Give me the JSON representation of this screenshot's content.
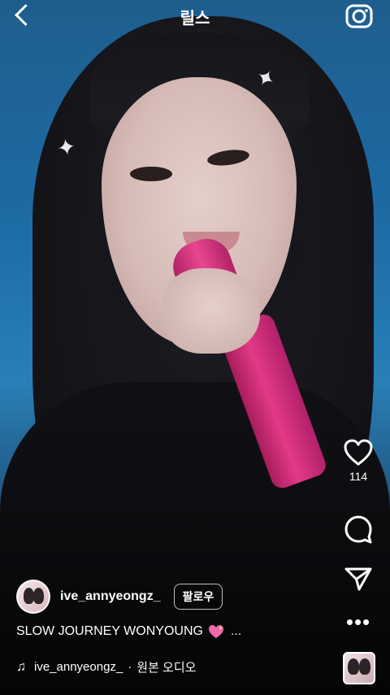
{
  "header": {
    "title": "릴스"
  },
  "actions": {
    "like_count": "114"
  },
  "post": {
    "username": "ive_annyeongz_",
    "follow_label": "팔로우",
    "caption": "SLOW JOURNEY WONYOUNG",
    "caption_more": "...",
    "audio_user": "ive_annyeongz_",
    "audio_separator": "·",
    "audio_label": "원본 오디오"
  },
  "colors": {
    "accent_mic": "#e23a86",
    "emoji_heart": "#f06aa8"
  }
}
